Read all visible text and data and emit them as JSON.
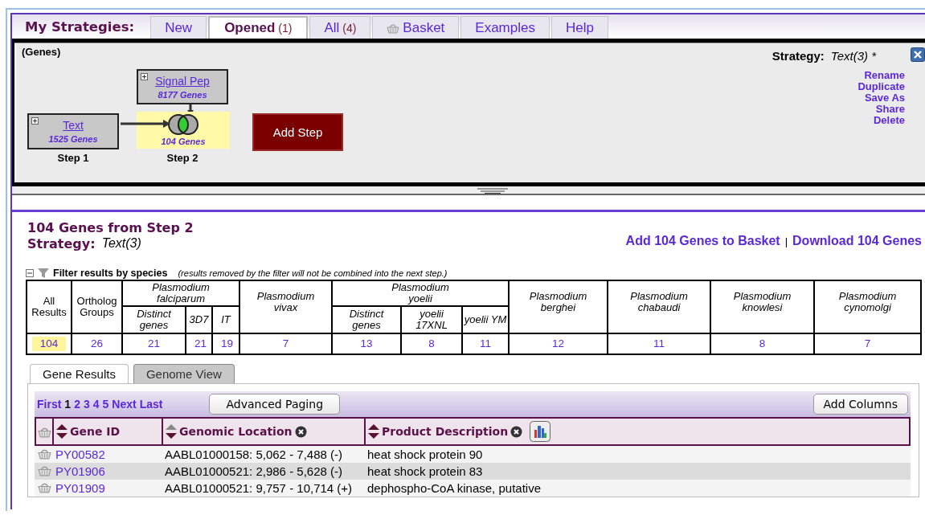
{
  "header": {
    "title": "My Strategies:",
    "tabs": [
      {
        "label": "New",
        "kind": "plain",
        "selected": false
      },
      {
        "label": "Opened",
        "count": "(1)",
        "kind": "plain",
        "selected": true
      },
      {
        "label": "All",
        "count": "(4)",
        "kind": "plain",
        "selected": false
      },
      {
        "label": "Basket",
        "kind": "basket",
        "selected": false
      },
      {
        "label": "Examples",
        "kind": "plain",
        "selected": false
      },
      {
        "label": "Help",
        "kind": "plain",
        "selected": false
      }
    ]
  },
  "strategy_panel": {
    "record_type": "(Genes)",
    "strategy_label": "Strategy:",
    "strategy_name": "Text(3) *",
    "actions": [
      "Rename",
      "Duplicate",
      "Save As",
      "Share",
      "Delete"
    ],
    "steps": [
      {
        "kind": "leaf",
        "name": "Text",
        "count": "1525 Genes",
        "label": "Step 1",
        "selected": false
      },
      {
        "kind": "combine",
        "count": "104 Genes",
        "label": "Step 2",
        "selected": true,
        "added": {
          "name": "Signal Pep",
          "count": "8177 Genes"
        }
      }
    ],
    "add_step": "Add Step"
  },
  "results": {
    "title": "104 Genes from Step 2",
    "strategy_label": "Strategy:",
    "strategy_name": "Text(3)",
    "basket_link": "Add 104 Genes to Basket",
    "separator": "|",
    "download_link": "Download 104 Genes",
    "filter": {
      "title": "Filter results by species",
      "note": "(results removed by the filter will not be combined into the next step.)",
      "expanded": true,
      "columns": [
        {
          "label": "All Results",
          "count": "104",
          "selected": true
        },
        {
          "label": "Ortholog Groups",
          "count": "26",
          "selected": false
        },
        {
          "label": "Plasmodium falciparum",
          "children": [
            {
              "label": "Distinct genes",
              "count": "21",
              "selected": false
            },
            {
              "label": "3D7",
              "count": "21",
              "selected": false
            },
            {
              "label": "IT",
              "count": "19",
              "selected": false
            }
          ]
        },
        {
          "label": "Plasmodium vivax",
          "count": "7",
          "selected": false
        },
        {
          "label": "Plasmodium yoelii",
          "children": [
            {
              "label": "Distinct genes",
              "count": "13",
              "selected": false
            },
            {
              "label": "yoelii 17XNL",
              "count": "8",
              "selected": false
            },
            {
              "label": "yoelii YM",
              "count": "11",
              "selected": false
            }
          ]
        },
        {
          "label": "Plasmodium berghei",
          "count": "12",
          "selected": false
        },
        {
          "label": "Plasmodium chabaudi",
          "count": "11",
          "selected": false
        },
        {
          "label": "Plasmodium knowlesi",
          "count": "8",
          "selected": false
        },
        {
          "label": "Plasmodium cynomolgi",
          "count": "7",
          "selected": false
        }
      ]
    },
    "view_tabs": [
      {
        "label": "Gene Results",
        "selected": true
      },
      {
        "label": "Genome View",
        "selected": false
      }
    ],
    "paging": {
      "first": "First",
      "pages": [
        {
          "label": "1",
          "selected": true
        },
        {
          "label": "2",
          "selected": false
        },
        {
          "label": "3",
          "selected": false
        },
        {
          "label": "4",
          "selected": false
        },
        {
          "label": "5",
          "selected": false
        }
      ],
      "next": "Next",
      "last": "Last",
      "advanced": "Advanced Paging",
      "add_columns": "Add Columns"
    },
    "table": {
      "columns": [
        {
          "label": "Gene ID",
          "removable": false,
          "chart": false
        },
        {
          "label": "Genomic Location",
          "removable": true,
          "chart": false
        },
        {
          "label": "Product Description",
          "removable": true,
          "chart": true
        }
      ],
      "rows": [
        {
          "gene_id": "PY00582",
          "location": "AABL01000158: 5,062 - 7,488 (-)",
          "description": "heat shock protein 90"
        },
        {
          "gene_id": "PY01906",
          "location": "AABL01000521: 2,986 - 5,628 (-)",
          "description": "heat shock protein 83"
        },
        {
          "gene_id": "PY01909",
          "location": "AABL01000521: 9,757 - 10,714 (+)",
          "description": "dephospho-CoA kinase, putative"
        }
      ]
    }
  }
}
